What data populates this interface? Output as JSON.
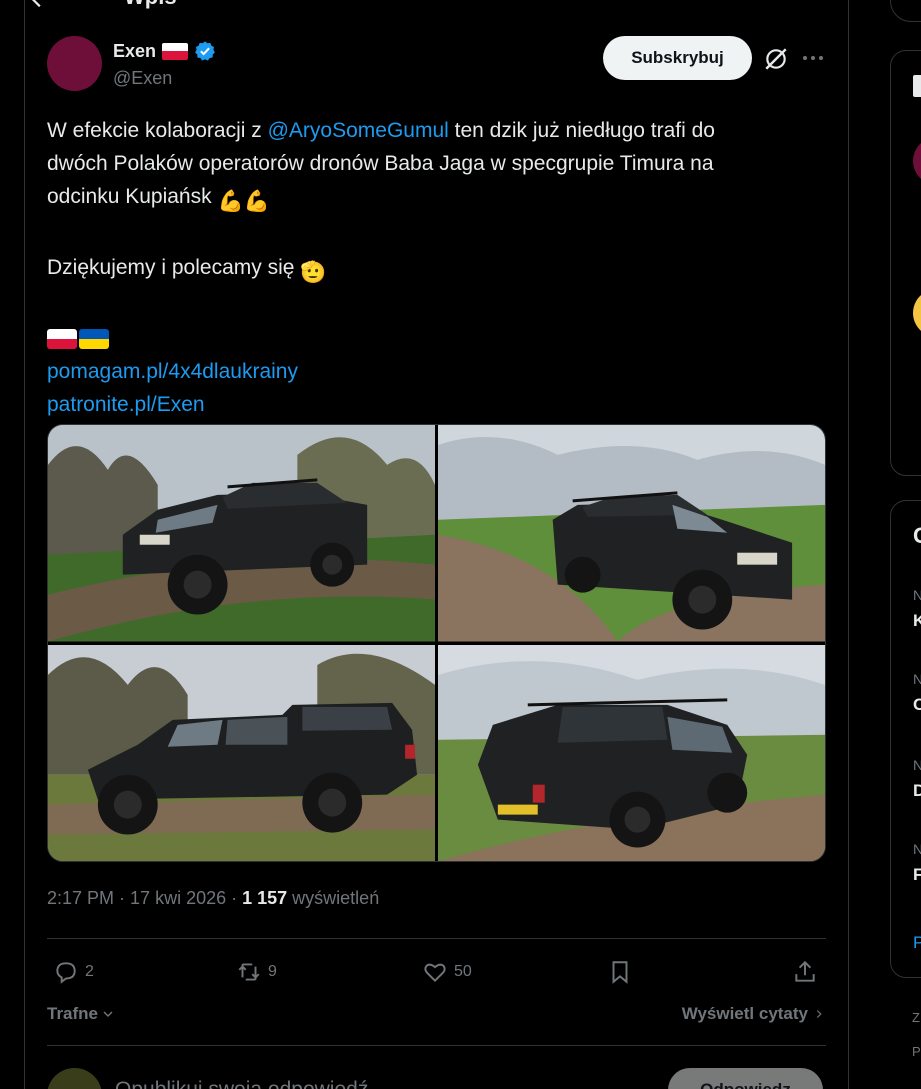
{
  "header": {
    "title": "Wpis"
  },
  "author": {
    "display_name": "Exen",
    "handle": "@Exen",
    "avatar_color": "#6e0f3a"
  },
  "actions_top": {
    "subscribe_label": "Subskrybuj"
  },
  "tweet": {
    "line1_a": "W efekcie kolaboracji z ",
    "mention": "@AryoSomeGumul",
    "line1_b": " ten dzik już niedługo trafi do",
    "line2": "dwóch Polaków operatorów dronów Baba Jaga w specgrupie Timura na",
    "line3": "odcinku Kupiańsk ",
    "emoji_muscle": "💪💪",
    "line4": "Dziękujemy i polecamy się ",
    "emoji_salute": "🫡",
    "link1": "pomagam.pl/4x4dlaukrainy",
    "link2": "patronite.pl/Exen"
  },
  "media": {
    "photos": [
      {
        "alt": "Czarny pickup na polnej drodze, widok z przodu"
      },
      {
        "alt": "Czarny pickup na polnej drodze, widok z przodu z prawej"
      },
      {
        "alt": "Czarny pickup, widok z boku"
      },
      {
        "alt": "Czarny pickup, widok z tyłu"
      }
    ]
  },
  "meta": {
    "time": "2:17 PM",
    "separator": " · ",
    "date": "17 kwi 2026",
    "views_count": "1 157",
    "views_label": " wyświetleń"
  },
  "engagement": {
    "replies": "2",
    "reposts": "9",
    "likes": "50"
  },
  "sort": {
    "left_label": "Trafne",
    "right_label": "Wyświetl cytaty"
  },
  "reply_box": {
    "placeholder": "Opublikuj swoją odpowiedź",
    "button_label": "Odpowiedz"
  },
  "sidebar": {
    "card2_heading": "C",
    "items": [
      {
        "small": "N",
        "bold": "K"
      },
      {
        "small": "N",
        "bold": "C"
      },
      {
        "small": "N",
        "bold": "D"
      },
      {
        "small": "N",
        "bold": "F"
      }
    ],
    "link": "P",
    "footer1": "Z",
    "footer2": "P"
  },
  "colors": {
    "accent": "#1d9bf0",
    "background": "#000000",
    "text": "#e7e9ea",
    "muted": "#71767b",
    "border": "#2f3336"
  }
}
